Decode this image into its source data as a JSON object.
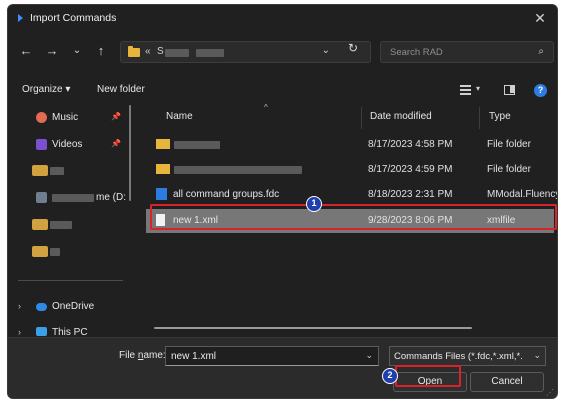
{
  "window": {
    "title": "Import Commands",
    "close_glyph": "✕"
  },
  "nav": {
    "back": "←",
    "forward": "→",
    "recent": "⌄",
    "up": "↑",
    "refresh": "↻"
  },
  "address": {
    "chevron": "«",
    "text": "S",
    "dropdown": "⌄"
  },
  "search": {
    "placeholder": "Search RAD",
    "icon": "⌕"
  },
  "toolbar": {
    "organize": "Organize ▾",
    "new_folder": "New folder",
    "view_dropdown": "▾",
    "help": "?"
  },
  "sidebar": {
    "pin_glyph": "📌",
    "items": [
      {
        "label": "Music",
        "icon": "music-icon",
        "color": "#e36a54",
        "pinned": true
      },
      {
        "label": "Videos",
        "icon": "videos-icon",
        "color": "#7a4fd0",
        "pinned": true
      },
      {
        "label": "",
        "icon": "folder-icon",
        "color": "#d1a23f"
      },
      {
        "label": "me (D:",
        "icon": "drive-icon",
        "color": "#6f7f8f"
      },
      {
        "label": "",
        "icon": "folder-icon",
        "color": "#d1a23f"
      },
      {
        "label": "",
        "icon": "folder-icon",
        "color": "#d1a23f"
      },
      {
        "label": "OneDrive",
        "icon": "onedrive-icon",
        "color": "#2f8ae5",
        "chevron": "›"
      },
      {
        "label": "This PC",
        "icon": "this-pc-icon",
        "color": "#3aa0e8",
        "chevron": "›"
      }
    ]
  },
  "columns": {
    "name": "Name",
    "date": "Date modified",
    "type": "Type",
    "sort_glyph": "^"
  },
  "files": [
    {
      "name": "",
      "date": "8/17/2023 4:58 PM",
      "type": "File folder",
      "icon": "folder-icon"
    },
    {
      "name": "",
      "date": "8/17/2023 4:59 PM",
      "type": "File folder",
      "icon": "folder-icon"
    },
    {
      "name": "all command groups.fdc",
      "date": "8/18/2023 2:31 PM",
      "type": "MModal.Fluency",
      "icon": "fdc-file-icon"
    },
    {
      "name": "new 1.xml",
      "date": "9/28/2023 8:06 PM",
      "type": "xmlfile",
      "icon": "xml-file-icon",
      "selected": true
    }
  ],
  "footer": {
    "file_name_label_pre": "File ",
    "file_name_label_accel": "n",
    "file_name_label_post": "ame:",
    "file_name_value": "new 1.xml",
    "file_type_value": "Commands Files (*.fdc,*.xml,*.",
    "open_accel": "O",
    "open_rest": "pen",
    "cancel": "Cancel",
    "dropdown": "⌄"
  },
  "annotations": {
    "badge_1": "1",
    "badge_2": "2",
    "color": "#d8232a"
  }
}
